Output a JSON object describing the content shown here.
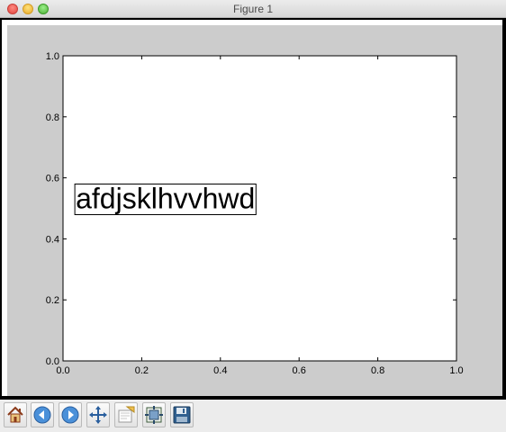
{
  "window": {
    "title": "Figure 1"
  },
  "toolbar": {
    "buttons": [
      {
        "name": "home-button",
        "icon": "home-icon"
      },
      {
        "name": "back-button",
        "icon": "back-arrow-icon"
      },
      {
        "name": "forward-button",
        "icon": "forward-arrow-icon"
      },
      {
        "name": "pan-button",
        "icon": "pan-arrows-icon"
      },
      {
        "name": "zoom-button",
        "icon": "zoom-rect-icon"
      },
      {
        "name": "subplots-button",
        "icon": "subplots-config-icon"
      },
      {
        "name": "save-button",
        "icon": "floppy-disk-icon"
      }
    ]
  },
  "chart_data": {
    "type": "scatter",
    "x": [],
    "y": [],
    "xlim": [
      0.0,
      1.0
    ],
    "ylim": [
      0.0,
      1.0
    ],
    "xticks": [
      "0.0",
      "0.2",
      "0.4",
      "0.6",
      "0.8",
      "1.0"
    ],
    "yticks": [
      "0.0",
      "0.2",
      "0.4",
      "0.6",
      "0.8",
      "1.0"
    ],
    "title": "",
    "xlabel": "",
    "ylabel": "",
    "grid": false,
    "annotations": [
      {
        "text": "afdjsklhvvhwd",
        "x": 0.03,
        "y": 0.5,
        "boxed": true
      }
    ]
  },
  "colors": {
    "figure_background": "#cccccc",
    "axes_background": "#ffffff",
    "axis_color": "#000000"
  }
}
